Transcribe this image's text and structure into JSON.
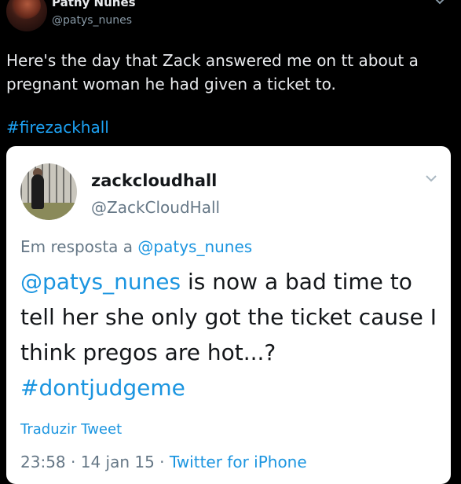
{
  "author": {
    "name": "Pathy Nunes",
    "handle": "@patys_nunes"
  },
  "tweet": {
    "text": "Here's the day that Zack answered me on tt about a pregnant woman he had given a ticket to.",
    "hashtag": "#firezackhall"
  },
  "quoted": {
    "name": "zackcloudhall",
    "handle": "@ZackCloudHall",
    "reply_prefix": "Em resposta a",
    "reply_to": "@patys_nunes",
    "mention": "@patys_nunes",
    "body": " is now a bad time to tell her she only got the ticket cause I think pregos are hot...? ",
    "hashtag": "#dontjudgeme",
    "translate_label": "Traduzir Tweet",
    "time": "23:58",
    "separator1": " · ",
    "date": "14 jan 15",
    "separator2": " · ",
    "source": "Twitter for iPhone"
  },
  "icons": {
    "caret": "chevron-down-icon"
  },
  "colors": {
    "background": "#000000",
    "link": "#1b95e0",
    "hashtag_dark": "#1da1f2"
  }
}
